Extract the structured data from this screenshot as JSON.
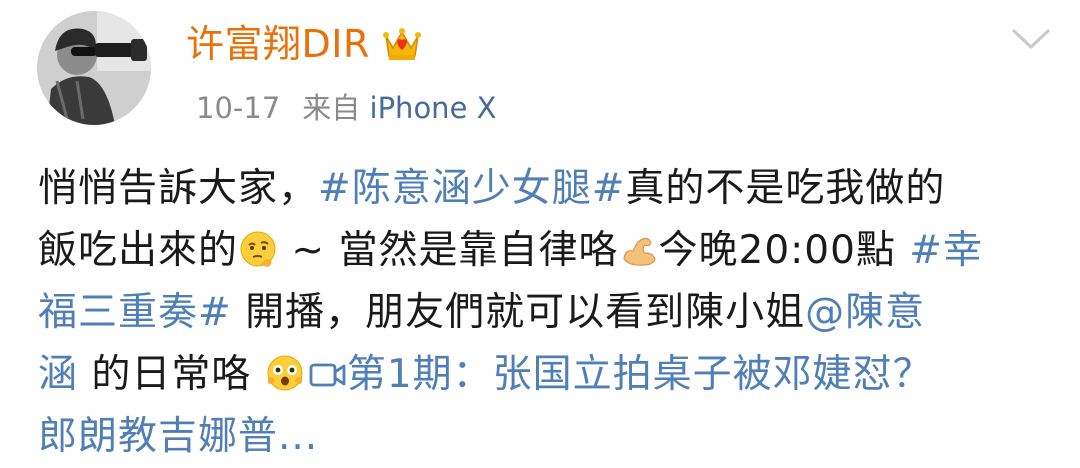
{
  "post_header": {
    "username": "许富翔DIR",
    "date": "10-17",
    "source_prefix": "来自",
    "device": "iPhone X"
  },
  "post": {
    "line1_text": "悄悄告訴大家，",
    "line1_tag": "#陈意涵少女腿#",
    "line1_rest": "真的不是吃我做的",
    "line2_text": "飯吃出來的",
    "line2_mid": " ~ 當然是靠自律咯",
    "line2_rest": "今晚20:00點 ",
    "line2_tag": "#幸",
    "line3_tag": "福三重奏#",
    "line3_text": " 開播，朋友們就可以看到陳小姐",
    "line3_mention": "@陳意",
    "line4_mention": "涵",
    "line4_text": " 的日常咯 ",
    "line4_link": "第1期：张国立拍桌子被邓婕怼？",
    "line5_link": "郎朗教吉娜普..."
  },
  "icons": {
    "verified": "crown-icon",
    "more": "chevron-down-icon",
    "emoji1": "thinking-face-emoji",
    "emoji2": "flexed-biceps-emoji",
    "emoji3": "star-struck-face-emoji",
    "video": "video-camera-icon"
  },
  "colors": {
    "username": "#e8710a",
    "link": "#4f7fb6",
    "meta": "#8a8a8a",
    "device": "#476a97",
    "text": "#1a1a1a"
  }
}
